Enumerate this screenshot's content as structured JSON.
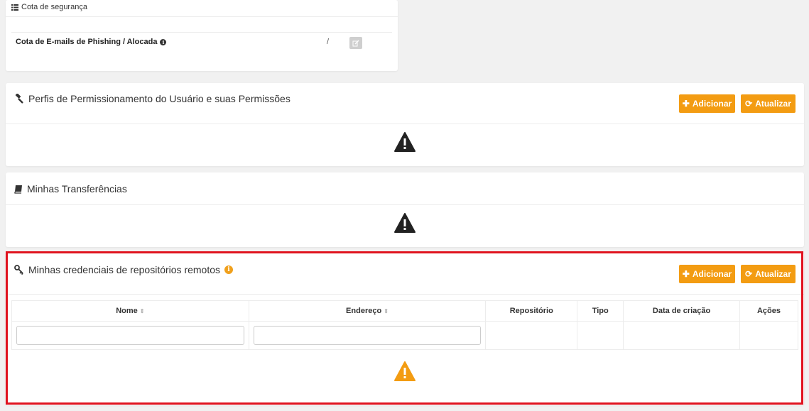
{
  "quota": {
    "header": "Cota de segurança",
    "header_icon": "list-icon",
    "label": "Cota de E-mails de Phishing / Alocada",
    "info_icon": "info-icon",
    "value": "/",
    "edit_icon": "edit-icon"
  },
  "perfis": {
    "title": "Perfis de Permissionamento do Usuário e suas Permissões",
    "icon": "gavel-icon",
    "add_label": "Adicionar",
    "refresh_label": "Atualizar",
    "warning_icon": "warning-icon",
    "warning_color": "#222222"
  },
  "transferencias": {
    "title": "Minhas Transferências",
    "icon": "book-icon",
    "warning_icon": "warning-icon",
    "warning_color": "#222222"
  },
  "credenciais": {
    "title": "Minhas credenciais de repositórios remotos",
    "icon": "key-icon",
    "info_icon": "info-icon",
    "add_label": "Adicionar",
    "refresh_label": "Atualizar",
    "columns": [
      "Nome",
      "Endereço",
      "Repositório",
      "Tipo",
      "Data de criação",
      "Ações"
    ],
    "filters": {
      "nome": "",
      "endereco": ""
    },
    "warning_icon": "warning-icon",
    "warning_color": "#f39c12",
    "highlight_color": "#e0131f"
  },
  "colors": {
    "accent": "#f39c12",
    "background": "#f1f1f1"
  }
}
